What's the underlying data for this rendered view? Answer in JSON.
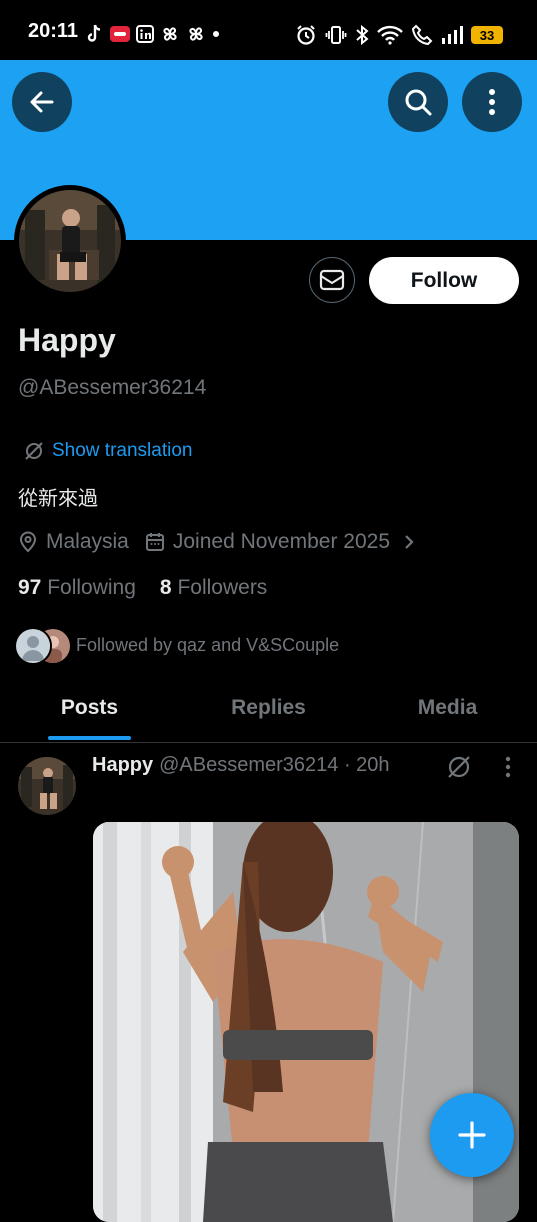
{
  "status_bar": {
    "time": "20:11",
    "battery": "33",
    "left_icons": [
      "tiktok-icon",
      "app-icon",
      "linkedin-icon",
      "pinwheel-icon",
      "pinwheel-icon",
      "dot-icon"
    ],
    "right_icons": [
      "alarm-icon",
      "vibrate-icon",
      "bluetooth-icon",
      "wifi-icon",
      "call-icon",
      "signal-icon"
    ]
  },
  "header": {
    "banner_color": "#1da1f2",
    "icons": [
      "back-arrow-icon",
      "search-icon",
      "more-vertical-icon"
    ]
  },
  "profile": {
    "follow_label": "Follow",
    "display_name": "Happy",
    "handle": "@ABessemer36214",
    "translate_label": "Show translation",
    "bio": "從新來過",
    "location": "Malaysia",
    "joined": "Joined November 2025",
    "following_count": "97",
    "following_label": "Following",
    "followers_count": "8",
    "followers_label": "Followers",
    "followed_by": "Followed by qaz and V&SCouple"
  },
  "tabs": [
    {
      "label": "Posts",
      "active": true
    },
    {
      "label": "Replies",
      "active": false
    },
    {
      "label": "Media",
      "active": false
    }
  ],
  "post": {
    "name": "Happy",
    "meta": "@ABessemer36214 · 20h"
  },
  "colors": {
    "accent": "#1d9bf0",
    "text_primary": "#e7e9ea",
    "text_secondary": "#71767b",
    "background": "#000000"
  }
}
